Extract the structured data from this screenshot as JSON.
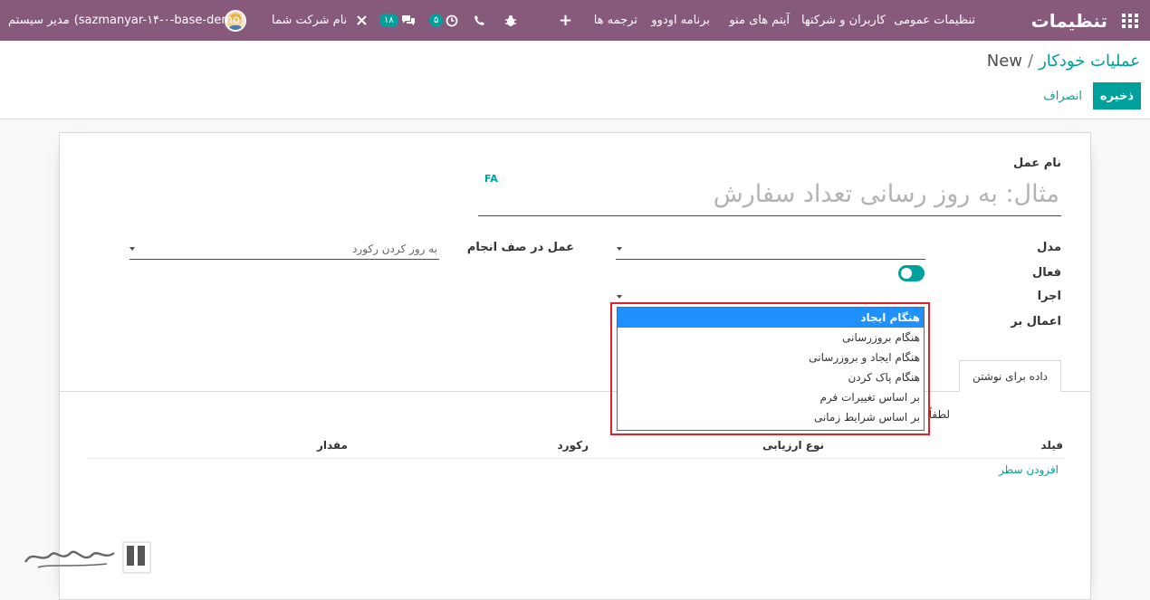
{
  "navbar": {
    "brand": "تنظیمات",
    "menu": [
      "تنظیمات عمومی",
      "کاربران و شرکتها",
      "آیتم های منو",
      "برنامه اودوو",
      "ترجمه ها"
    ],
    "activity_count": "۵",
    "messages_count": "۱۸",
    "company": "نام شرکت شما",
    "user_name": "مدیر سیستم",
    "database": "(sazmanyar-۱۴-۰-base-demo)",
    "colors": {
      "navbar": "#875a7b",
      "accent": "#00a09d"
    }
  },
  "breadcrumb": {
    "parent": "عملیات خودکار",
    "separator": "/",
    "current": "New"
  },
  "buttons": {
    "save": "ذخیره",
    "discard": "انصراف"
  },
  "form": {
    "name_label": "نام عمل",
    "name_placeholder": "مثال: به روز رسانی تعداد سفارش",
    "lang": "FA",
    "model_label": "مدل",
    "active_label": "فعال",
    "trigger_label": "اجرا",
    "apply_on_label": "اعمال بر",
    "action_label": "عمل در صف انجام",
    "action_value": "به روز کردن رکورد",
    "trigger_options": [
      "هنگام ایجاد",
      "هنگام بروزرسانی",
      "هنگام ایجاد و بروزرسانی",
      "هنگام پاک کردن",
      "بر اساس تغییرات فرم",
      "بر اساس شرایط زمانی"
    ],
    "trigger_selected_index": 0
  },
  "tabs": {
    "data_to_write": "داده برای نوشتن"
  },
  "notebook": {
    "info_text": "لطفاً برای ایجاد، قبل از انتخاب",
    "columns": {
      "field": "فیلد",
      "evaluation_type": "نوع ارزیابی",
      "record": "رکورد",
      "value": "مقدار"
    },
    "add_line": "افزودن سطر"
  },
  "watermark": {
    "text": "تسهیلگستر"
  }
}
